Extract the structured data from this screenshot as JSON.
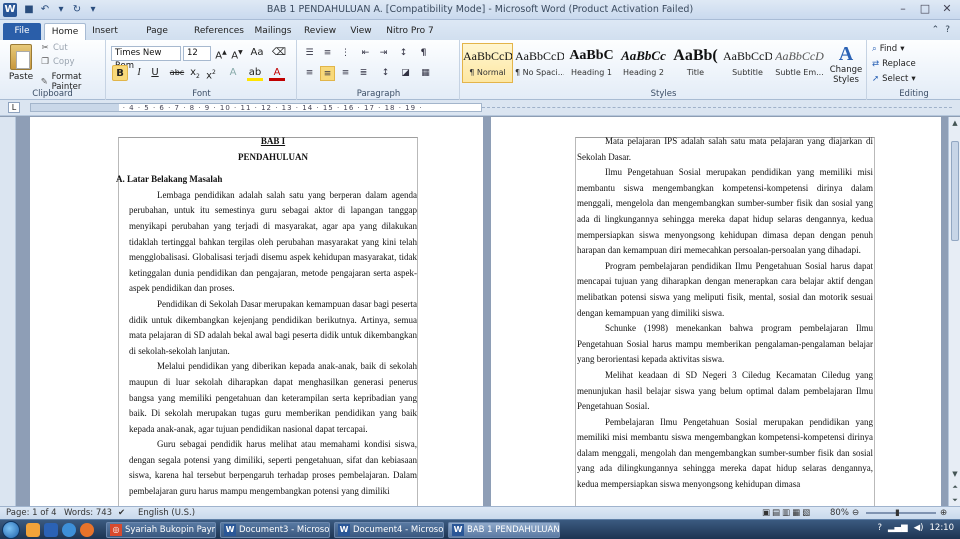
{
  "window": {
    "title": "BAB 1 PENDAHULUAN  A. [Compatibility Mode] - Microsoft Word (Product Activation Failed)"
  },
  "tabs": [
    "File",
    "Home",
    "Insert",
    "Page Layout",
    "References",
    "Mailings",
    "Review",
    "View",
    "Nitro Pro 7"
  ],
  "clipboard": {
    "paste": "Paste",
    "cut": "Cut",
    "copy": "Copy",
    "format_painter": "Format Painter",
    "label": "Clipboard"
  },
  "font": {
    "name": "Times New Rom",
    "size": "12",
    "label": "Font"
  },
  "paragraph": {
    "label": "Paragraph"
  },
  "styles": {
    "label": "Styles",
    "items": [
      {
        "preview": "AaBbCcD",
        "name": "¶ Normal"
      },
      {
        "preview": "AaBbCcD",
        "name": "¶ No Spaci..."
      },
      {
        "preview": "AaBbC",
        "name": "Heading 1"
      },
      {
        "preview": "AaBbCc",
        "name": "Heading 2"
      },
      {
        "preview": "AaBb(",
        "name": "Title"
      },
      {
        "preview": "AaBbCcD",
        "name": "Subtitle"
      },
      {
        "preview": "AaBbCcD",
        "name": "Subtle Em..."
      }
    ],
    "change_styles": "Change Styles"
  },
  "editing": {
    "find": "Find",
    "replace": "Replace",
    "select": "Select",
    "label": "Editing"
  },
  "page1": {
    "chapter": "BAB I",
    "title": "PENDAHULUAN",
    "heading": "A.   Latar Belakang Masalah",
    "paragraphs": [
      "Lembaga pendidikan adalah salah satu yang berperan dalam agenda perubahan, untuk itu semestinya guru sebagai aktor di lapangan tanggap menyikapi perubahan yang terjadi di masyarakat, agar apa yang dilakukan tidaklah tertinggal bahkan tergilas oleh perubahan masyarakat yang kini telah mengglobalisasi. Globalisasi terjadi disemu aspek kehidupan masyarakat, tidak ketinggalan dunia pendidikan dan pengajaran, metode pengajaran serta aspek-aspek pendidikan dan proses.",
      "Pendidikan di Sekolah Dasar merupakan kemampuan dasar bagi peserta didik untuk dikembangkan kejenjang pendidikan berikutnya. Artinya, semua mata pelajaran di SD adalah bekal awal bagi peserta didik untuk dikembangkan di sekolah-sekolah lanjutan.",
      "Melalui pendidikan yang diberikan kepada anak-anak, baik di sekolah maupun di luar sekolah diharapkan dapat menghasilkan generasi penerus bangsa yang memiliki pengetahuan dan keterampilan serta kepribadian yang baik. Di sekolah merupakan tugas guru memberikan pendidikan yang baik kepada anak-anak, agar tujuan pendidikan nasional dapat tercapai.",
      "Guru sebagai pendidik harus melihat atau memahami kondisi siswa, dengan segala potensi yang dimiliki, seperti pengetahuan, sifat dan kebiasaan siswa, karena hal tersebut berpengaruh terhadap proses pembelajaran. Dalam pembelajaran guru harus mampu mengembangkan potensi yang dimiliki"
    ]
  },
  "page2": {
    "paragraphs": [
      "Mata pelajaran IPS adalah salah satu mata pelajaran yang diajarkan di Sekolah Dasar.",
      "Ilmu Pengetahuan Sosial merupakan pendidikan yang memiliki misi membantu siswa mengembangkan kompetensi-kompetensi dirinya dalam menggali, mengelola dan mengembangkan sumber-sumber fisik dan sosial yang ada di lingkungannya sehingga mereka dapat hidup selaras dengannya, kedua mempersiapkan siswa menyongsong kehidupan dimasa depan dengan penuh harapan dan kemampuan diri memecahkan persoalan-persoalan yang dihadapi.",
      "Program pembelajaran pendidikan Ilmu Pengetahuan Sosial harus dapat mencapai tujuan yang diharapkan dengan menerapkan cara belajar aktif dengan melibatkan potensi siswa yang meliputi fisik, mental, sosial dan motorik sesuai dengan kemampuan yang dimiliki siswa.",
      "Schunke (1998) menekankan bahwa program pembelajaran Ilmu Pengetahuan Sosial harus mampu memberikan pengalaman-pengalaman belajar yang berorientasi kepada aktivitas siswa.",
      "Melihat keadaan di SD Negeri 3 Ciledug Kecamatan Ciledug yang menunjukan hasil belajar siswa yang belum optimal dalam pembelajaran Ilmu Pengetahuan Sosial.",
      "Pembelajaran Ilmu Pengetahuan Sosial merupakan pendidikan yang memiliki misi membantu siswa mengembangkan kompetensi-kompetensi dirinya dalam menggali, mengolah dan mengembangkan sumber-sumber fisik dan sosial yang ada dilingkungannya sehingga mereka dapat hidup selaras dengannya, kedua mempersiapkan siswa menyongsong kehidupan dimasa"
    ]
  },
  "status": {
    "page": "Page: 1 of 4",
    "words": "Words: 743",
    "language": "English (U.S.)",
    "zoom": "80%"
  },
  "taskbar": {
    "tasks": [
      "Syariah Bukopin Paym...",
      "Document3 - Microsoft...",
      "Document4 - Microsoft...",
      "BAB 1 PENDAHULUAN ..."
    ],
    "clock": "12:10"
  }
}
